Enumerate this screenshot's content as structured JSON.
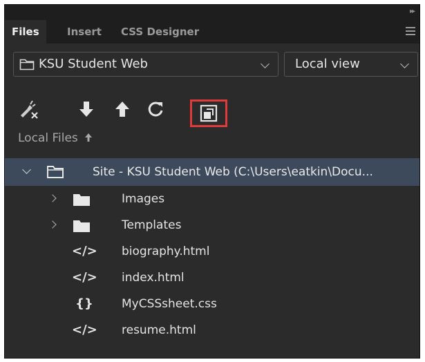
{
  "tabs": [
    {
      "label": "Files",
      "active": true
    },
    {
      "label": "Insert",
      "active": false
    },
    {
      "label": "CSS Designer",
      "active": false
    }
  ],
  "site_dropdown": {
    "value": "KSU Student Web",
    "icon": "folder-outline-icon"
  },
  "view_dropdown": {
    "value": "Local view"
  },
  "toolbar": [
    {
      "name": "connect-icon"
    },
    {
      "name": "get-download-icon"
    },
    {
      "name": "put-upload-icon"
    },
    {
      "name": "refresh-icon"
    },
    {
      "name": "expand-panel-icon",
      "highlighted": true
    }
  ],
  "files_header": {
    "label": "Local Files",
    "sort_icon": "sort-up-arrow-icon"
  },
  "tree": {
    "root": {
      "label": "Site - KSU Student Web (C:\\Users\\eatkin\\Docu..."
    },
    "items": [
      {
        "label": "Images",
        "type": "folder"
      },
      {
        "label": "Templates",
        "type": "folder"
      },
      {
        "label": "biography.html",
        "type": "html",
        "icon_text": "</>"
      },
      {
        "label": "index.html",
        "type": "html",
        "icon_text": "</>"
      },
      {
        "label": "MyCSSsheet.css",
        "type": "css",
        "icon_text": "{}"
      },
      {
        "label": "resume.html",
        "type": "html",
        "icon_text": "</>"
      }
    ]
  },
  "colors": {
    "panel_bg": "#2b2b2b",
    "tab_bar_bg": "#1e1e1e",
    "selected_row": "#3c4a5c",
    "highlight": "#e03a3a"
  }
}
